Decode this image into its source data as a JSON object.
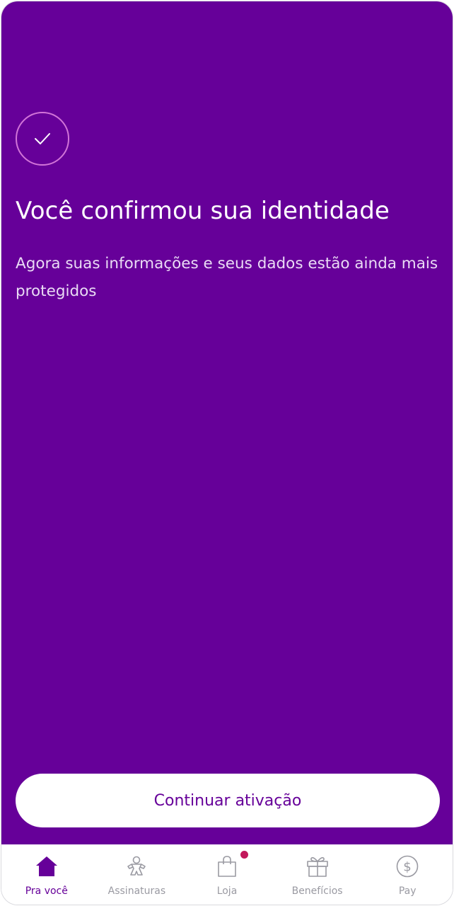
{
  "confirmation": {
    "title": "Você confirmou sua identidade",
    "subtitle": "Agora suas informações e seus dados estão ainda mais protegidos",
    "cta_label": "Continuar ativação"
  },
  "tabbar": {
    "items": [
      {
        "label": "Pra você",
        "icon": "home-icon",
        "active": true
      },
      {
        "label": "Assinaturas",
        "icon": "subscriptions-icon",
        "active": false
      },
      {
        "label": "Loja",
        "icon": "shopping-bag-icon",
        "active": false,
        "badge": true
      },
      {
        "label": "Benefícios",
        "icon": "gift-icon",
        "active": false
      },
      {
        "label": "Pay",
        "icon": "dollar-circle-icon",
        "active": false
      }
    ]
  },
  "colors": {
    "brand": "#660099",
    "check_ring": "#d274d8",
    "badge": "#c2185b",
    "inactive_tab": "#9a9aa2"
  }
}
